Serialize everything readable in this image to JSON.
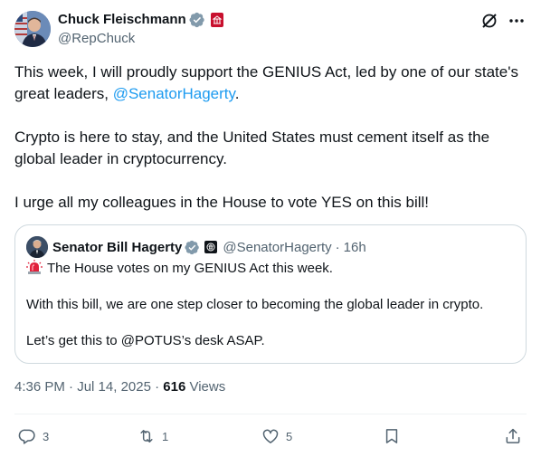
{
  "author": {
    "display_name": "Chuck Fleischmann",
    "handle": "@RepChuck",
    "avatar": "avatar-photo",
    "verified_icon": "verified-badge-icon",
    "affiliation_icon": "house-seal-icon"
  },
  "top_actions": {
    "grok_icon": "grok-icon",
    "more_icon": "more-dots-icon"
  },
  "tweet": {
    "line1_pre": "This week, I will proudly support the GENIUS Act, led by one of our state's great leaders, ",
    "line1_mention": "@SenatorHagerty",
    "line1_post": ".",
    "para2": "Crypto is here to stay, and the United States must cement itself as the global leader in cryptocurrency.",
    "para3": "I urge all my colleagues in the House to vote YES on this bill!"
  },
  "quote": {
    "display_name": "Senator Bill Hagerty",
    "handle": "@SenatorHagerty",
    "separator": "·",
    "time": "16h",
    "line1": "The House votes on my GENIUS Act this week.",
    "line2": "With this bill, we are one step closer to becoming the global leader in crypto.",
    "line3": "Let’s get this to @POTUS’s desk ASAP.",
    "emoji_icon": "rotating-light-icon"
  },
  "meta": {
    "time": "4:36 PM",
    "sep1": " · ",
    "date": "Jul 14, 2025",
    "sep2": " · ",
    "views_count": "616",
    "views_label": " Views"
  },
  "actions": {
    "replies": "3",
    "reposts": "1",
    "likes": "5",
    "bookmark_icon": "bookmark-icon",
    "share_icon": "share-icon"
  },
  "colors": {
    "text": "#0f1419",
    "secondary": "#536471",
    "link": "#1d9bf0",
    "border": "#cfd9de",
    "verified": "#829aab"
  }
}
